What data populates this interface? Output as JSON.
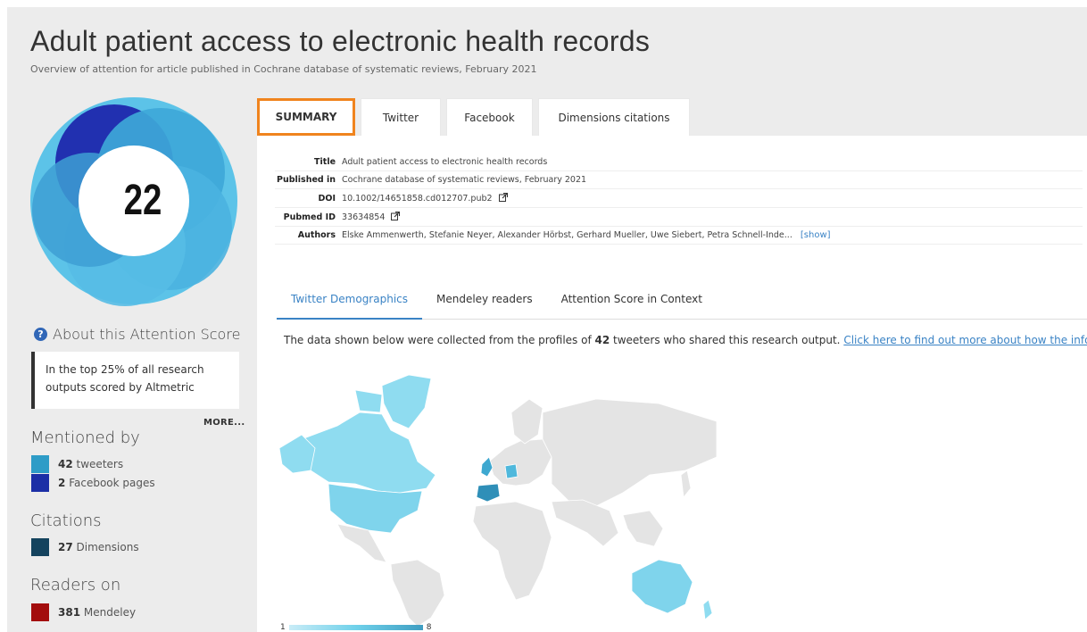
{
  "header": {
    "title": "Adult patient access to electronic health records",
    "subtitle": "Overview of attention for article published in Cochrane database of systematic reviews, February 2021"
  },
  "score": {
    "value": "22",
    "about_label": "About this Attention Score",
    "rank_text": "In the top 25% of all research outputs scored by Altmetric",
    "more_label": "MORE..."
  },
  "mentioned_by": {
    "heading": "Mentioned by",
    "items": [
      {
        "count": "42",
        "label": "tweeters",
        "color": "#2e9cc7"
      },
      {
        "count": "2",
        "label": "Facebook pages",
        "color": "#1c2fa6"
      }
    ]
  },
  "citations": {
    "heading": "Citations",
    "items": [
      {
        "count": "27",
        "label": "Dimensions",
        "color": "#14435e"
      }
    ]
  },
  "readers": {
    "heading": "Readers on",
    "items": [
      {
        "count": "381",
        "label": "Mendeley",
        "color": "#a30d0d"
      }
    ]
  },
  "tabs": [
    "SUMMARY",
    "Twitter",
    "Facebook",
    "Dimensions citations"
  ],
  "meta": {
    "title_key": "Title",
    "title_val": "Adult patient access to electronic health records",
    "pub_key": "Published in",
    "pub_val": "Cochrane database of systematic reviews, February 2021",
    "doi_key": "DOI",
    "doi_val": "10.1002/14651858.cd012707.pub2",
    "pmid_key": "Pubmed ID",
    "pmid_val": "33634854",
    "authors_key": "Authors",
    "authors_val": "Elske Ammenwerth, Stefanie Neyer, Alexander Hörbst, Gerhard Mueller, Uwe Siebert, Petra Schnell-Inde...",
    "show_label": "[show]"
  },
  "subtabs": [
    "Twitter Demographics",
    "Mendeley readers",
    "Attention Score in Context"
  ],
  "intro": {
    "before": "The data shown below were collected from the profiles of ",
    "count": "42",
    "after": " tweeters who shared this research output. ",
    "link": "Click here to find out more about how the informati"
  },
  "map_scale": {
    "min": "1",
    "max": "8"
  },
  "colors": {
    "accent": "#f0841e",
    "link": "#3a83c5"
  }
}
